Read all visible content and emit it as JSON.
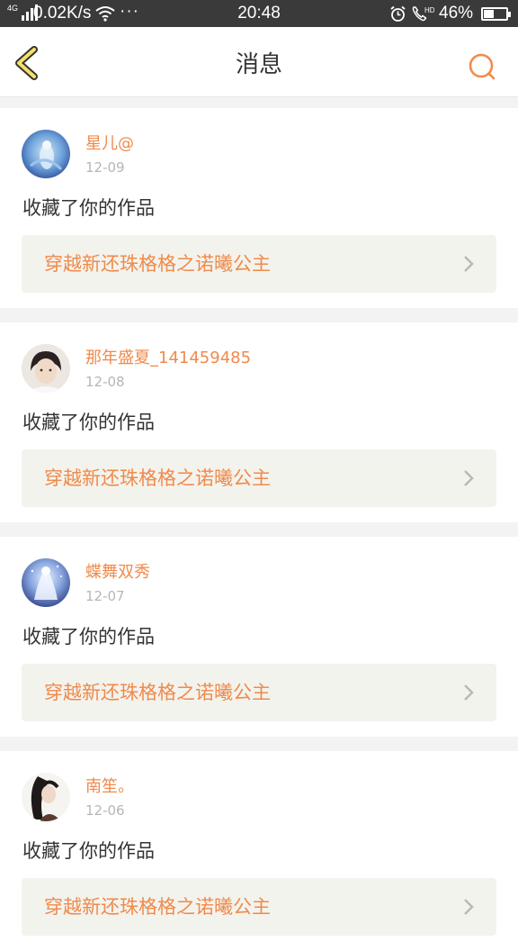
{
  "status_bar": {
    "network_label": "4G",
    "speed": "0.02K/s",
    "more": "···",
    "time": "20:48",
    "battery_percent": "46%",
    "battery_level": 0.46,
    "icons": [
      "signal-icon",
      "wifi-icon",
      "alarm-icon",
      "hd-call-icon",
      "battery-icon"
    ]
  },
  "header": {
    "title": "消息",
    "back_icon": "back-chevron-icon",
    "search_icon": "search-icon",
    "accent_color": "#f08a4b"
  },
  "messages": [
    {
      "user": "星儿@",
      "date": "12-09",
      "action": "收藏了你的作品",
      "work_title": "穿越新还珠格格之诺曦公主"
    },
    {
      "user": "那年盛夏_141459485",
      "date": "12-08",
      "action": "收藏了你的作品",
      "work_title": "穿越新还珠格格之诺曦公主"
    },
    {
      "user": "蝶舞双秀",
      "date": "12-07",
      "action": "收藏了你的作品",
      "work_title": "穿越新还珠格格之诺曦公主"
    },
    {
      "user": "南笙。",
      "date": "12-06",
      "action": "收藏了你的作品",
      "work_title": "穿越新还珠格格之诺曦公主"
    }
  ]
}
